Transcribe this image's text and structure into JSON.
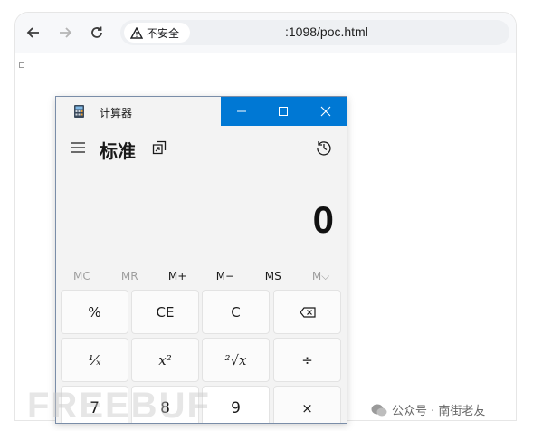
{
  "browser": {
    "security_label": "不安全",
    "url": ":1098/poc.html"
  },
  "calculator": {
    "window_title": "计算器",
    "mode_title": "标准",
    "display_value": "0",
    "memory_buttons": [
      "MC",
      "MR",
      "M+",
      "M−",
      "MS",
      "M⌵"
    ],
    "keys": [
      [
        "%",
        "CE",
        "C",
        "⌫"
      ],
      [
        "¹⁄ₓ",
        "x²",
        "²√x",
        "÷"
      ],
      [
        "7",
        "8",
        "9",
        "×"
      ]
    ]
  },
  "watermark": {
    "brand": "FREEBUF",
    "account": "公众号 · 南街老友"
  }
}
